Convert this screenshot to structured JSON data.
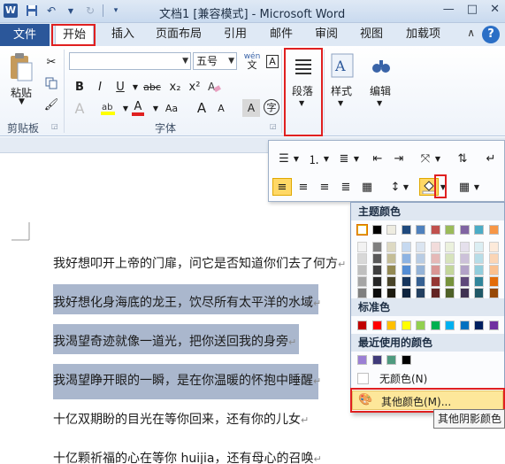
{
  "window": {
    "title": "文档1 [兼容模式] - Microsoft Word",
    "app_icon_letter": "W",
    "controls": [
      "—",
      "□",
      "✕"
    ]
  },
  "tabs": {
    "file": "文件",
    "items": [
      "开始",
      "插入",
      "页面布局",
      "引用",
      "邮件",
      "审阅",
      "视图",
      "加载项"
    ],
    "active": "开始",
    "help": "?"
  },
  "ribbon": {
    "clipboard": {
      "paste": "粘贴",
      "group": "剪贴板"
    },
    "font": {
      "font_name": "",
      "font_size": "五号",
      "group": "字体",
      "wen_icon": "wén",
      "a_buttons": [
        "A",
        "A"
      ],
      "format_buttons": [
        "B",
        "I",
        "U",
        "abc",
        "x₂",
        "x²",
        "A",
        "A",
        "Aa",
        "A",
        "字"
      ]
    },
    "paragraph": {
      "label": "段落"
    },
    "styles": {
      "label": "样式"
    },
    "editing": {
      "label": "编辑"
    }
  },
  "document": {
    "lines": [
      "我好想叩开上帝的门扉，问它是否知道你们去了何方",
      "我好想化身海底的龙王，饮尽所有太平洋的水域",
      "我渴望奇迹就像一道光，把你送回我的身旁",
      "我渴望睁开眼的一瞬，是在你温暖的怀抱中睡醒",
      "十亿双期盼的目光在等你回来，还有你的儿女",
      "十亿颗祈福的心在等你 huijia，还有母心的召唤"
    ],
    "paragraph_mark": "↵"
  },
  "color_menu": {
    "theme_header": "主题颜色",
    "standard_header": "标准色",
    "recent_header": "最近使用的颜色",
    "no_color": "无颜色(N)",
    "more_colors": "其他颜色(M)...",
    "tooltip": "其他阴影颜色",
    "theme_top": [
      "#ffffff",
      "#000000",
      "#eeece1",
      "#1f497d",
      "#4f81bd",
      "#c0504d",
      "#9bbb59",
      "#8064a2",
      "#4bacc6",
      "#f79646"
    ],
    "theme_shades": [
      [
        "#f2f2f2",
        "#7f7f7f",
        "#ddd9c3",
        "#c6d9f0",
        "#dbe5f1",
        "#f2dcdb",
        "#ebf1dd",
        "#e5e0ec",
        "#dbeef3",
        "#fdeada"
      ],
      [
        "#d8d8d8",
        "#595959",
        "#c4bd97",
        "#8db3e2",
        "#b8cce4",
        "#e5b9b7",
        "#d7e3bc",
        "#ccc1d9",
        "#b7dde8",
        "#fbd5b5"
      ],
      [
        "#bfbfbf",
        "#3f3f3f",
        "#938953",
        "#548dd4",
        "#95b3d7",
        "#d99694",
        "#c3d69b",
        "#b2a2c7",
        "#92cddc",
        "#fac08f"
      ],
      [
        "#a5a5a5",
        "#262626",
        "#494429",
        "#17365d",
        "#366092",
        "#953734",
        "#76923c",
        "#5f497a",
        "#31859b",
        "#e36c09"
      ],
      [
        "#7f7f7f",
        "#0c0c0c",
        "#1d1b10",
        "#0f243e",
        "#244061",
        "#632423",
        "#4f6128",
        "#3f3151",
        "#205867",
        "#974806"
      ]
    ],
    "standard": [
      "#c00000",
      "#ff0000",
      "#ffc000",
      "#ffff00",
      "#92d050",
      "#00b050",
      "#00b0f0",
      "#0070c0",
      "#002060",
      "#7030a0"
    ],
    "recent": [
      "#9b7fd4",
      "#403b7a",
      "#4f9a7f",
      "#000000"
    ]
  },
  "colors": {
    "accent": "#2b579a",
    "highlight": "#aab7cd",
    "annotation": "#e02020"
  }
}
